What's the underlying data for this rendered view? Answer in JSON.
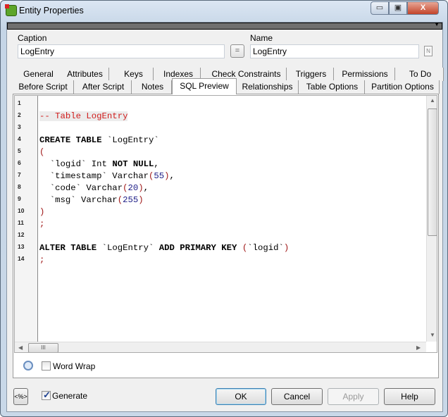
{
  "window": {
    "title": "Entity Properties",
    "minimize": "▭",
    "maximize": "▣",
    "close": "X"
  },
  "fields": {
    "caption_label": "Caption",
    "caption_value": "LogEntry",
    "equals_label": "=",
    "name_label": "Name",
    "name_value": "LogEntry",
    "name_icon_label": "N"
  },
  "tabs_row1": [
    "General",
    "Attributes",
    "Keys",
    "Indexes",
    "Check Constraints",
    "Triggers",
    "Permissions",
    "To Do"
  ],
  "tabs_row2": [
    "Before Script",
    "After Script",
    "Notes",
    "SQL Preview",
    "Relationships",
    "Table Options",
    "Partition Options"
  ],
  "selected_tab": "SQL Preview",
  "editor": {
    "line_numbers": [
      "1",
      "2",
      "3",
      "4",
      "5",
      "6",
      "7",
      "8",
      "9",
      "10",
      "11",
      "12",
      "13",
      "14"
    ],
    "lines": [
      [],
      [
        {
          "t": "-- Table LogEntry",
          "c": "cm"
        }
      ],
      [],
      [
        {
          "t": "CREATE TABLE",
          "c": "kw"
        },
        {
          "t": " `LogEntry`",
          "c": "tx"
        }
      ],
      [
        {
          "t": "(",
          "c": "pn"
        }
      ],
      [
        {
          "t": "  `logid` Int ",
          "c": "tx"
        },
        {
          "t": "NOT NULL",
          "c": "kw"
        },
        {
          "t": ",",
          "c": "tx"
        }
      ],
      [
        {
          "t": "  `timestamp` Varchar",
          "c": "tx"
        },
        {
          "t": "(",
          "c": "pn"
        },
        {
          "t": "55",
          "c": "nm"
        },
        {
          "t": ")",
          "c": "pn"
        },
        {
          "t": ",",
          "c": "tx"
        }
      ],
      [
        {
          "t": "  `code` Varchar",
          "c": "tx"
        },
        {
          "t": "(",
          "c": "pn"
        },
        {
          "t": "20",
          "c": "nm"
        },
        {
          "t": ")",
          "c": "pn"
        },
        {
          "t": ",",
          "c": "tx"
        }
      ],
      [
        {
          "t": "  `msg` Varchar",
          "c": "tx"
        },
        {
          "t": "(",
          "c": "pn"
        },
        {
          "t": "255",
          "c": "nm"
        },
        {
          "t": ")",
          "c": "pn"
        }
      ],
      [
        {
          "t": ")",
          "c": "pn"
        }
      ],
      [
        {
          "t": ";",
          "c": "pn"
        }
      ],
      [],
      [
        {
          "t": "ALTER TABLE",
          "c": "kw"
        },
        {
          "t": " `LogEntry` ",
          "c": "tx"
        },
        {
          "t": "ADD PRIMARY KEY",
          "c": "kw"
        },
        {
          "t": " ",
          "c": "tx"
        },
        {
          "t": "(",
          "c": "pn"
        },
        {
          "t": "`logid`",
          "c": "tx"
        },
        {
          "t": ")",
          "c": "pn"
        }
      ],
      [
        {
          "t": ";",
          "c": "pn"
        }
      ]
    ],
    "hscroll_thumb": "III"
  },
  "options": {
    "word_wrap_label": "Word Wrap",
    "word_wrap_checked": false,
    "generate_label": "Generate",
    "generate_checked": true,
    "template_button": "<%>"
  },
  "buttons": {
    "ok": "OK",
    "cancel": "Cancel",
    "apply": "Apply",
    "help": "Help"
  }
}
